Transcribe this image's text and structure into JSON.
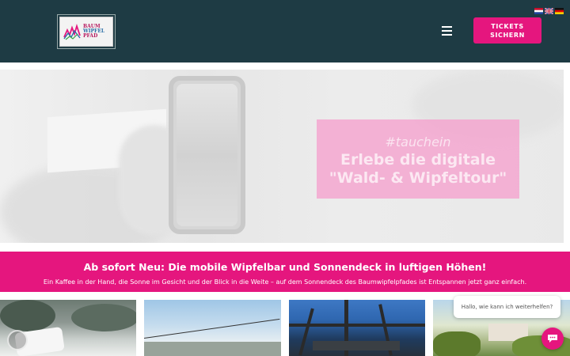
{
  "header": {
    "logo_alt": "Baumwipfelpfad",
    "logo_lines": [
      "BAUM",
      "WIPFEL",
      "PFAD"
    ],
    "tickets_label": "TICKETS\nSICHERN",
    "languages": [
      "nl",
      "en",
      "de"
    ]
  },
  "hero": {
    "tag": "#tauchein",
    "title_line1": "Erlebe die digitale",
    "title_line2": "\"Wald- & Wipfeltour\""
  },
  "banner": {
    "title": "Ab sofort Neu: Die mobile Wipfelbar und Sonnendeck in luftigen Höhen!",
    "subtitle": "Ein Kaffee in der Hand, die Sonne im Gesicht und der Blick in die Weite – auf dem Sonnendeck des Baumwipfelpfades ist Entspannen jetzt ganz einfach."
  },
  "chat": {
    "prompt": "Hallo, wie kann ich weiterhelfen?"
  },
  "colors": {
    "header_bg": "#1e3b44",
    "accent": "#e5167e"
  },
  "icons": {
    "menu": "hamburger-icon",
    "chat": "chat-icon"
  }
}
